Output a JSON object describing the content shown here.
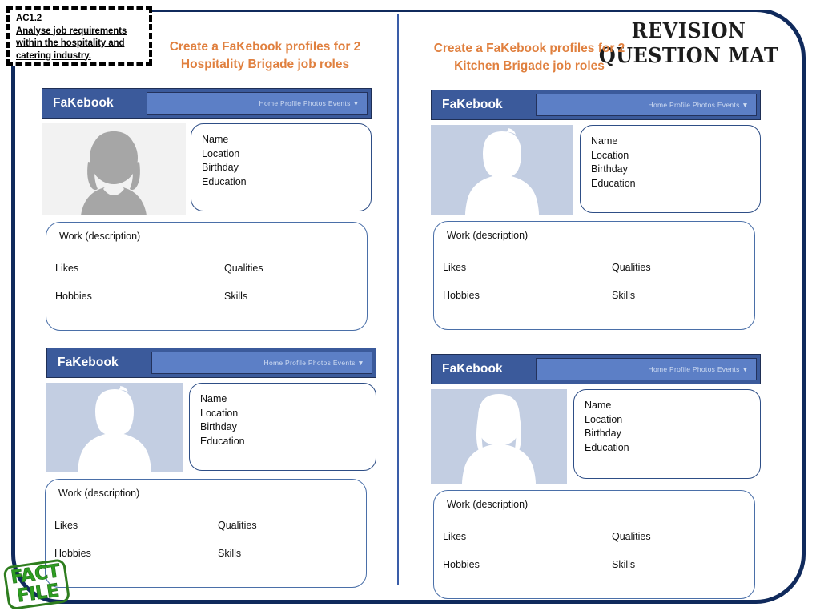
{
  "document": {
    "title_line1": "REVISION",
    "title_line2": "QUESTION MAT"
  },
  "assessment_criteria": {
    "code": "AC1.2",
    "line1": "Analyse job requirements",
    "line2": "within the hospitality and",
    "line3": "catering industry."
  },
  "stamp": {
    "line1": "FACT",
    "line2": "FILE"
  },
  "columns": [
    {
      "heading_line1": "Create a FaKebook profiles for 2",
      "heading_line2": "Hospitality Brigade job roles"
    },
    {
      "heading_line1": "Create a FaKebook profiles for 2",
      "heading_line2": "Kitchen Brigade job roles"
    }
  ],
  "profile_template": {
    "brand": "FaKebook",
    "nav_links": "Home Profile Photos Events ▼",
    "info_fields": [
      "Name",
      "Location",
      "Birthday",
      "Education"
    ],
    "work_title": "Work (description)",
    "work_cells": {
      "likes": "Likes",
      "qualities": "Qualities",
      "hobbies": "Hobbies",
      "skills": "Skills"
    }
  },
  "profiles": [
    {
      "id": "left-top",
      "brand": "FaKebook",
      "nav_links": "Home Profile Photos Events ▼",
      "avatar_style": "grey-female",
      "info_fields": [
        "Name",
        "Location",
        "Birthday",
        "Education"
      ],
      "work_title": "Work (description)",
      "likes": "Likes",
      "qualities": "Qualities",
      "hobbies": "Hobbies",
      "skills": "Skills"
    },
    {
      "id": "right-top",
      "brand": "FaKebook",
      "nav_links": "Home Profile Photos Events ▼",
      "avatar_style": "blue-male",
      "info_fields": [
        "Name",
        "Location",
        "Birthday",
        "Education"
      ],
      "work_title": "Work (description)",
      "likes": "Likes",
      "qualities": "Qualities",
      "hobbies": "Hobbies",
      "skills": "Skills"
    },
    {
      "id": "left-bottom",
      "brand": "FaKebook",
      "nav_links": "Home Profile Photos Events ▼",
      "avatar_style": "blue-male",
      "info_fields": [
        "Name",
        "Location",
        "Birthday",
        "Education"
      ],
      "work_title": "Work (description)",
      "likes": "Likes",
      "qualities": "Qualities",
      "hobbies": "Hobbies",
      "skills": "Skills"
    },
    {
      "id": "right-bottom",
      "brand": "FaKebook",
      "nav_links": "Home Profile Photos Events ▼",
      "avatar_style": "blue-female",
      "info_fields": [
        "Name",
        "Location",
        "Birthday",
        "Education"
      ],
      "work_title": "Work (description)",
      "likes": "Likes",
      "qualities": "Qualities",
      "hobbies": "Hobbies",
      "skills": "Skills"
    }
  ],
  "colors": {
    "frame_navy": "#102A5C",
    "divider_blue": "#3A5DA8",
    "heading_orange": "#E0803F",
    "fb_header_blue": "#3B5A9B",
    "fb_nav_blue": "#5C7FC6",
    "card_border_blue": "#2E4E86",
    "avatar_grey_bg": "#F2F2F2",
    "avatar_blue_bg": "#C3CEE2",
    "stamp_green": "#2E9E22"
  }
}
